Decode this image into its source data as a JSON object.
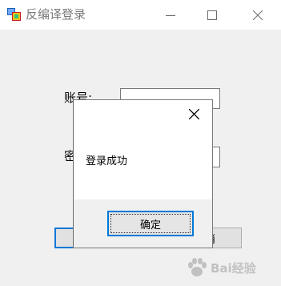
{
  "window": {
    "title": "反编译登录"
  },
  "form": {
    "account_label": "账号:",
    "password_label_partial": "密",
    "confirm_button_label": "",
    "cancel_button_label_partial": "消"
  },
  "dialog": {
    "message": "登录成功",
    "ok_label": "确定"
  },
  "watermark": {
    "text": "Bai经验"
  },
  "colors": {
    "accent": "#0078d7",
    "window_bg": "#f0f0f0",
    "titlebar_bg": "#ffffff"
  },
  "icons": [
    "app-icon",
    "minimize-icon",
    "maximize-icon",
    "close-icon",
    "dialog-close-icon"
  ]
}
